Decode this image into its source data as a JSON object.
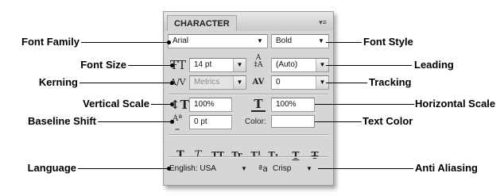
{
  "panel": {
    "tab_label": "CHARACTER",
    "menu_icon": "panel-menu-icon",
    "font_family": "Arial",
    "font_style": "Bold",
    "font_size": "14 pt",
    "leading": "(Auto)",
    "kerning": "Metrics",
    "tracking": "0",
    "vertical_scale": "100%",
    "horizontal_scale": "100%",
    "baseline_shift": "0 pt",
    "color_label": "Color:",
    "color_value": "#ffffff",
    "language": "English: USA",
    "anti_aliasing": "Crisp",
    "style_buttons": [
      {
        "name": "faux-bold-button",
        "glyph": "T"
      },
      {
        "name": "faux-italic-button",
        "glyph": "T"
      },
      {
        "name": "all-caps-button",
        "glyph": "TT"
      },
      {
        "name": "small-caps-button",
        "glyph": "Tr"
      },
      {
        "name": "superscript-button",
        "glyph": "T¹"
      },
      {
        "name": "subscript-button",
        "glyph": "T₁"
      },
      {
        "name": "underline-button",
        "glyph": "T"
      },
      {
        "name": "strikethrough-button",
        "glyph": "T"
      }
    ]
  },
  "callouts": {
    "font_family": "Font Family",
    "font_style": "Font Style",
    "font_size": "Font Size",
    "leading": "Leading",
    "kerning": "Kerning",
    "tracking": "Tracking",
    "vertical_scale": "Vertical Scale",
    "horizontal_scale": "Horizontal Scale",
    "baseline_shift": "Baseline Shift",
    "text_color": "Text Color",
    "language": "Language",
    "anti_aliasing": "Anti Aliasing"
  }
}
